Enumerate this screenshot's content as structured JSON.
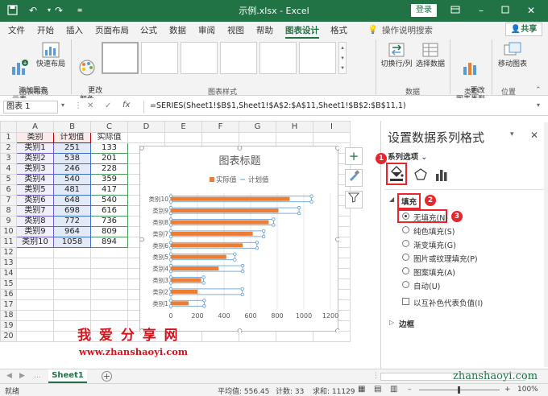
{
  "titlebar": {
    "title": "示例.xlsx - Excel",
    "login": "登录"
  },
  "tabs": [
    "文件",
    "开始",
    "插入",
    "页面布局",
    "公式",
    "数据",
    "审阅",
    "视图",
    "帮助",
    "图表设计",
    "格式"
  ],
  "active_tab": "图表设计",
  "tell_me": "操作说明搜索",
  "share": "共享",
  "ribbon": {
    "add_element": "添加图表\n元素",
    "quick_layout": "快速布局",
    "change_color": "更改\n颜色",
    "switch_row_col": "切换行/列",
    "select_data": "选择数据",
    "change_type": "更改\n图表类型",
    "move_chart": "移动图表",
    "groups": {
      "layout": "图表布局",
      "styles": "图表样式",
      "data": "数据",
      "type": "类型",
      "location": "位置"
    }
  },
  "formula": {
    "namebox": "图表 1",
    "fx": "fx",
    "content": "=SERIES(Sheet1!$B$1,Sheet1!$A$2:$A$11,Sheet1!$B$2:$B$11,1)"
  },
  "grid": {
    "columns": [
      "A",
      "B",
      "C",
      "D",
      "E",
      "F",
      "G",
      "H",
      "I"
    ],
    "header_row": [
      "类别",
      "计划值",
      "实际值"
    ],
    "rows": [
      [
        "类别1",
        "251",
        "133"
      ],
      [
        "类别2",
        "538",
        "201"
      ],
      [
        "类别3",
        "246",
        "228"
      ],
      [
        "类别4",
        "540",
        "359"
      ],
      [
        "类别5",
        "481",
        "417"
      ],
      [
        "类别6",
        "648",
        "540"
      ],
      [
        "类别7",
        "698",
        "616"
      ],
      [
        "类别8",
        "772",
        "736"
      ],
      [
        "类别9",
        "964",
        "809"
      ],
      [
        "类别10",
        "1058",
        "894"
      ]
    ],
    "row_numbers": [
      "1",
      "2",
      "3",
      "4",
      "5",
      "6",
      "7",
      "8",
      "9",
      "10",
      "11",
      "12",
      "13",
      "14",
      "15",
      "16",
      "17",
      "18",
      "19",
      "20"
    ]
  },
  "chart_data": {
    "type": "bar",
    "title": "图表标题",
    "categories": [
      "类别1",
      "类别2",
      "类别3",
      "类别4",
      "类别5",
      "类别6",
      "类别7",
      "类别8",
      "类别9",
      "类别10"
    ],
    "series": [
      {
        "name": "实际值",
        "values": [
          133,
          201,
          228,
          359,
          417,
          540,
          616,
          736,
          809,
          894
        ],
        "color": "#ed7d31"
      },
      {
        "name": "计划值",
        "values": [
          251,
          538,
          246,
          540,
          481,
          648,
          698,
          772,
          964,
          1058
        ],
        "color": "#5b9bd5"
      }
    ],
    "xlim": [
      0,
      1200
    ],
    "xticks": [
      "0",
      "200",
      "400",
      "600",
      "800",
      "1000",
      "1200"
    ],
    "orientation": "horizontal",
    "legend": "top"
  },
  "pane": {
    "title": "设置数据系列格式",
    "series_options": "系列选项",
    "section_fill": "填充",
    "fill_options": [
      "无填充(N)",
      "纯色填充(S)",
      "渐变填充(G)",
      "图片或纹理填充(P)",
      "图案填充(A)",
      "自动(U)"
    ],
    "selected_fill": "无填充(N)",
    "invert_label": "以互补色代表负值(I)",
    "section_border": "边框"
  },
  "badges": [
    "1",
    "2",
    "3"
  ],
  "watermark": {
    "line1": "我 爱 分 享 网",
    "line2": "www.zhanshaoyi.com",
    "corner": "zhanshaoyi.com"
  },
  "sheet_tab": "Sheet1",
  "status": {
    "ready": "就绪",
    "average": "平均值: 556.45",
    "count": "计数: 33",
    "sum": "求和: 11129",
    "zoom": "100%"
  },
  "colors": {
    "excel_green": "#217346",
    "accent_orange": "#ed7d31",
    "accent_blue": "#5b9bd5",
    "badge_red": "#e8242c"
  }
}
